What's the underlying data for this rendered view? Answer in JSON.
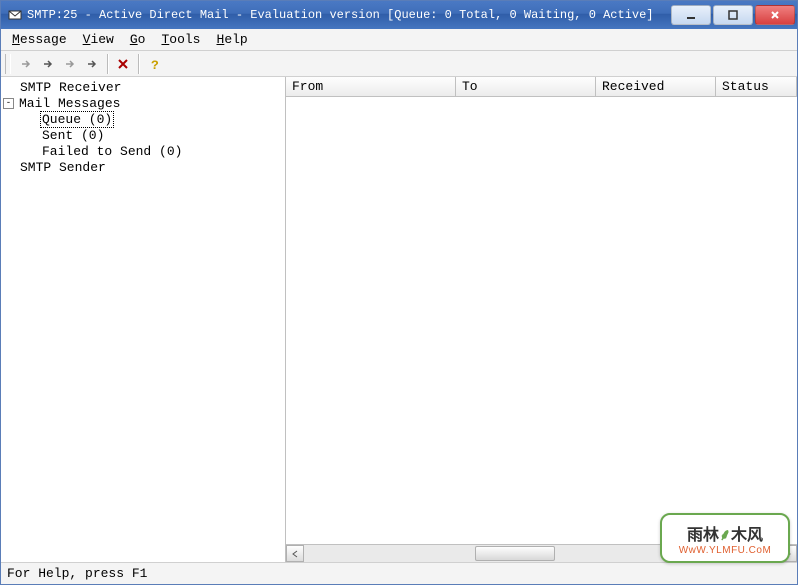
{
  "title": "SMTP:25 - Active Direct Mail - Evaluation version [Queue:    0 Total, 0 Waiting, 0 Active]",
  "menus": {
    "message": "Message",
    "view": "View",
    "go": "Go",
    "tools": "Tools",
    "help": "Help"
  },
  "toolbar_icons": {
    "arrow1": "arrow-right-dim",
    "arrow2": "arrow-right",
    "arrow3": "arrow-right-dim",
    "arrow4": "arrow-right",
    "delete": "delete-x",
    "help": "help-question"
  },
  "tree": {
    "smtp_receiver": "SMTP Receiver",
    "mail_messages": "Mail Messages",
    "queue": "Queue (0)",
    "sent": "Sent (0)",
    "failed": "Failed to Send (0)",
    "smtp_sender": "SMTP Sender"
  },
  "columns": {
    "from": "From",
    "to": "To",
    "received": "Received",
    "status": "Status"
  },
  "status": "For Help, press F1",
  "watermark": {
    "line1a": "雨林",
    "leaf": "⸙",
    "line1b": "木风",
    "line2": "WwW.YLMFU.CoM"
  }
}
